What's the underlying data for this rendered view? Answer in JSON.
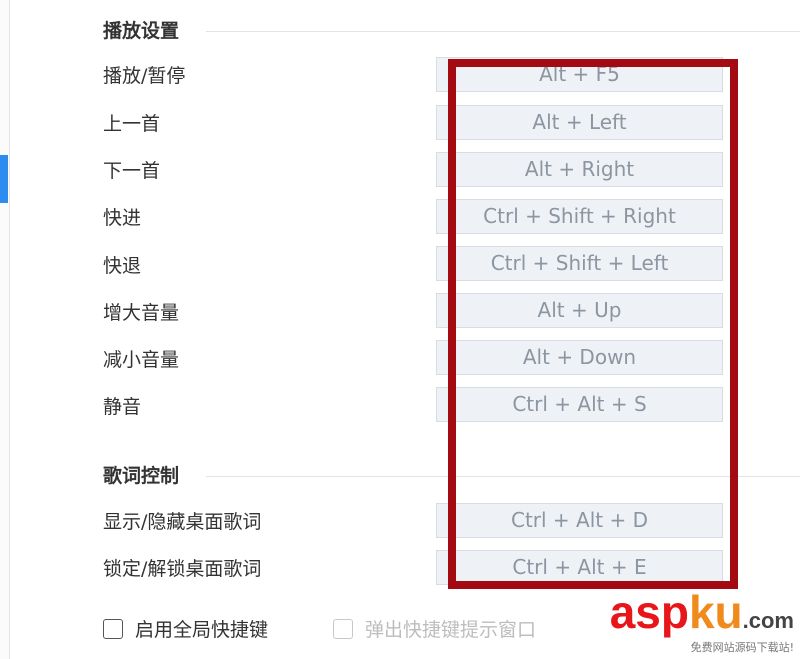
{
  "sections": [
    {
      "title": "播放设置",
      "rows": [
        {
          "label": "播放/暂停",
          "shortcut": "Alt + F5"
        },
        {
          "label": "上一首",
          "shortcut": "Alt + Left"
        },
        {
          "label": "下一首",
          "shortcut": "Alt + Right"
        },
        {
          "label": "快进",
          "shortcut": "Ctrl + Shift + Right"
        },
        {
          "label": "快退",
          "shortcut": "Ctrl + Shift + Left"
        },
        {
          "label": "增大音量",
          "shortcut": "Alt + Up"
        },
        {
          "label": "减小音量",
          "shortcut": "Alt + Down"
        },
        {
          "label": "静音",
          "shortcut": "Ctrl + Alt + S"
        }
      ]
    },
    {
      "title": "歌词控制",
      "rows": [
        {
          "label": "显示/隐藏桌面歌词",
          "shortcut": "Ctrl + Alt + D"
        },
        {
          "label": "锁定/解锁桌面歌词",
          "shortcut": "Ctrl + Alt + E"
        }
      ]
    }
  ],
  "options": {
    "global_hotkeys": {
      "label": "启用全局快捷键",
      "checked": false,
      "enabled": true
    },
    "hint_popup": {
      "label": "弹出快捷键提示窗口",
      "checked": false,
      "enabled": false
    }
  },
  "watermark": {
    "brand_main": "asp",
    "brand_accent": "ku",
    "brand_suffix": ".com",
    "tagline": "免费网站源码下载站!"
  },
  "colors": {
    "highlight": "#a30a12",
    "accent": "#2d8cf0",
    "key_box_bg": "#eef2f7",
    "watermark_red": "#e8151a",
    "watermark_orange": "#f08a1d"
  }
}
